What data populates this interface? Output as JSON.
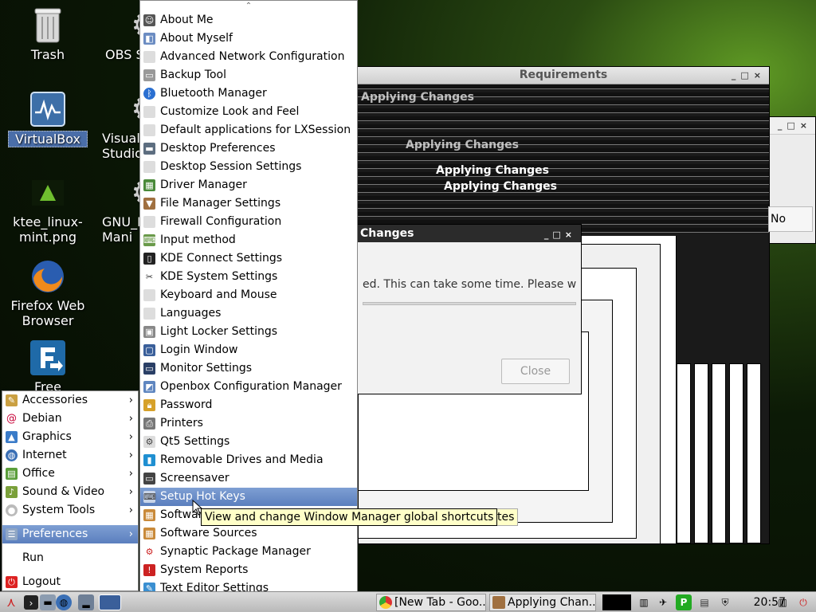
{
  "desktop": {
    "icons": [
      {
        "label": "Trash"
      },
      {
        "label": "VirtualBox"
      },
      {
        "label": "ktee_linux-mint.png"
      },
      {
        "label": "Firefox Web Browser"
      },
      {
        "label": "Free"
      },
      {
        "label": "OBS S"
      },
      {
        "label": "Visual Studio"
      },
      {
        "label": "GNU_I Mani"
      }
    ]
  },
  "windows": {
    "requirements_title": "Requirements",
    "ghost_texts": [
      "Applying Changes",
      "Applying Changes",
      "Applying Changes",
      "Applying Changes"
    ],
    "no_button": "No",
    "dialog": {
      "title": "Changes",
      "message": "ed. This can take some time. Please wait.",
      "close_label": "Close"
    },
    "btn_minimize": "_",
    "btn_maximize": "□",
    "btn_close": "×"
  },
  "main_menu": {
    "items": [
      {
        "label": "Accessories",
        "icon": "accessories-icon"
      },
      {
        "label": "Debian",
        "icon": "debian-icon"
      },
      {
        "label": "Graphics",
        "icon": "graphics-icon"
      },
      {
        "label": "Internet",
        "icon": "internet-icon"
      },
      {
        "label": "Office",
        "icon": "office-icon"
      },
      {
        "label": "Sound & Video",
        "icon": "sound-video-icon"
      },
      {
        "label": "System Tools",
        "icon": "system-tools-icon"
      },
      {
        "label": "Preferences",
        "icon": "preferences-icon"
      },
      {
        "label": "Run",
        "icon": ""
      },
      {
        "label": "Logout",
        "icon": "logout-icon"
      }
    ],
    "arrow": "›"
  },
  "preferences_menu": {
    "scroll_up": "⌃",
    "scroll_down": "⌄",
    "items": [
      {
        "label": "About Me"
      },
      {
        "label": "About Myself"
      },
      {
        "label": "Advanced Network Configuration"
      },
      {
        "label": "Backup Tool"
      },
      {
        "label": "Bluetooth Manager"
      },
      {
        "label": "Customize Look and Feel"
      },
      {
        "label": "Default applications for LXSession"
      },
      {
        "label": "Desktop Preferences"
      },
      {
        "label": "Desktop Session Settings"
      },
      {
        "label": "Driver Manager"
      },
      {
        "label": "File Manager Settings"
      },
      {
        "label": "Firewall Configuration"
      },
      {
        "label": "Input method"
      },
      {
        "label": "KDE Connect Settings"
      },
      {
        "label": "KDE System Settings"
      },
      {
        "label": "Keyboard and Mouse"
      },
      {
        "label": "Languages"
      },
      {
        "label": "Light Locker Settings"
      },
      {
        "label": "Login Window"
      },
      {
        "label": "Monitor Settings"
      },
      {
        "label": "Openbox Configuration Manager"
      },
      {
        "label": "Password"
      },
      {
        "label": "Printers"
      },
      {
        "label": "Qt5 Settings"
      },
      {
        "label": "Removable Drives and Media"
      },
      {
        "label": "Screensaver"
      },
      {
        "label": "Setup Hot Keys"
      },
      {
        "label": "Software"
      },
      {
        "label": "Software Sources"
      },
      {
        "label": "Synaptic Package Manager"
      },
      {
        "label": "System Reports"
      },
      {
        "label": "Text Editor Settings"
      }
    ],
    "highlighted_index": 26
  },
  "tooltip": {
    "text": "View and change Window Manager global shortcuts",
    "tail": "odates"
  },
  "taskbar": {
    "tasks": [
      {
        "label": "[New Tab - Goo..."
      },
      {
        "label": "Applying Chan..."
      }
    ],
    "clock": "20:57"
  },
  "colors": {
    "highlight": "#5b7fbe",
    "tooltip_bg": "#ffffc8"
  }
}
